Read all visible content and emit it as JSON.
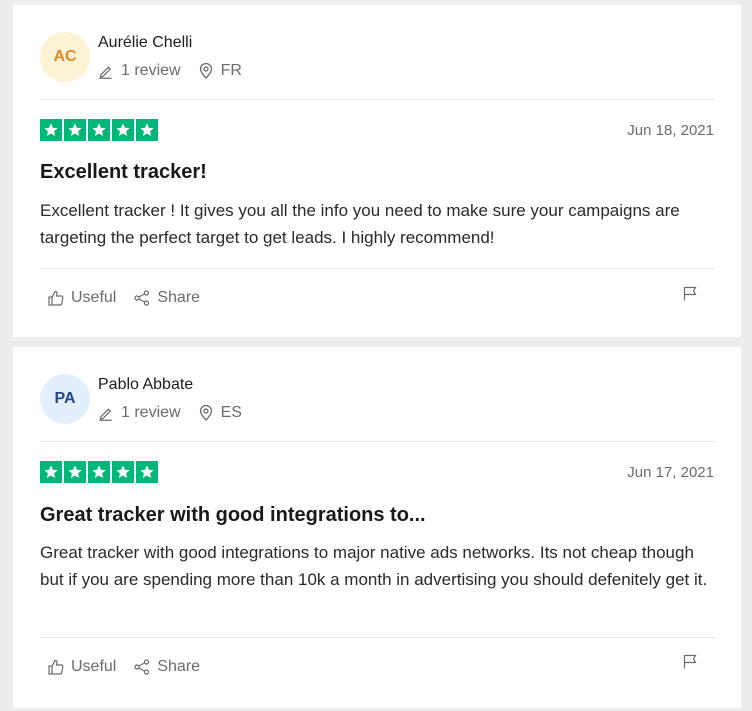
{
  "reviews": [
    {
      "initials": "AC",
      "name": "Aurélie Chelli",
      "review_count": "1 review",
      "country": "FR",
      "rating": 5,
      "date": "Jun 18, 2021",
      "title": "Excellent tracker!",
      "body": "Excellent tracker ! It gives you all the info you need to make sure your campaigns are targeting the perfect target to get leads. I highly recommend!",
      "useful_label": "Useful",
      "share_label": "Share"
    },
    {
      "initials": "PA",
      "name": "Pablo Abbate",
      "review_count": "1 review",
      "country": "ES",
      "rating": 5,
      "date": "Jun 17, 2021",
      "title": "Great tracker with good integrations to...",
      "body": "Great tracker with good integrations to major native ads networks. Its not cheap though but if you are spending more than 10k a month in advertising you should defenitely get it.",
      "useful_label": "Useful",
      "share_label": "Share"
    }
  ],
  "colors": {
    "star_green": "#00b67a",
    "avatar_1_bg": "#fcf3d4",
    "avatar_2_bg": "#e3effe"
  },
  "icons": [
    "pencil-icon",
    "location-pin-icon",
    "star-icon",
    "thumbs-up-icon",
    "share-icon",
    "flag-icon"
  ]
}
